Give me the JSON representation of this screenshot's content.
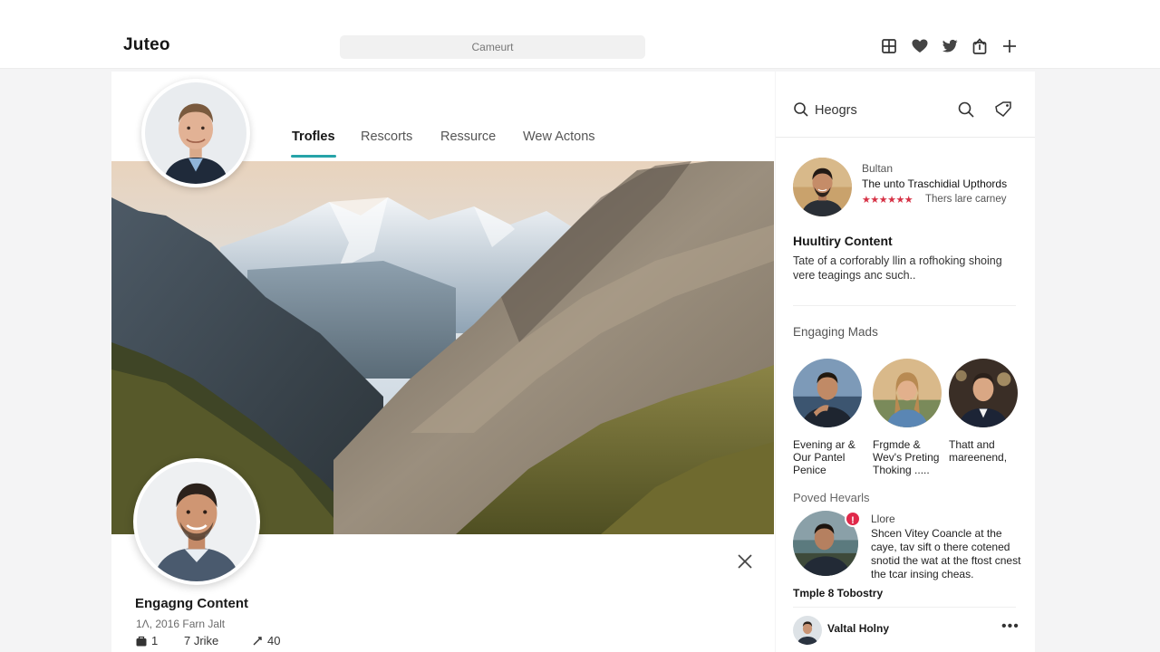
{
  "header": {
    "logo": "Juteo",
    "search_text": "Cameurt",
    "icons": [
      "grid-icon",
      "heart-icon",
      "bird-icon",
      "upload-icon",
      "plus-icon"
    ]
  },
  "main": {
    "tabs": [
      {
        "label": "Trofles",
        "active": true
      },
      {
        "label": "Rescorts",
        "active": false
      },
      {
        "label": "Ressurce",
        "active": false
      },
      {
        "label": "Wew Actons",
        "active": false
      }
    ],
    "post": {
      "title": "Engagng Content",
      "meta": "1Ʌ, 2016 Farn Jalt",
      "stats": {
        "comments": "1",
        "likes": "7 Jrike",
        "shares": "40"
      }
    }
  },
  "sidebar": {
    "header_label": "Heogrs",
    "featured": {
      "name": "Bultan",
      "title": "The unto Traschidial Upthords",
      "stars": "★★★★★★",
      "subtitle": "Thers lare carney"
    },
    "highlight": {
      "title": "Huultiry Content",
      "body": "Tate of a corforably llin a rofhoking shoing vere teagings anc such.."
    },
    "engaging": {
      "title": "Engaging Mads",
      "items": [
        {
          "caption": "Evening ar & Our Pantel Penice"
        },
        {
          "caption": "Frgmde & Wev's Preting Thoking ....."
        },
        {
          "caption": "Thatt and mareenend,"
        }
      ]
    },
    "poved": {
      "title": "Poved Hevarls",
      "badge": "!",
      "name": "Llore",
      "body": "Shcen Vitey Coancle at the caye, tav sift o there cotened snotid the wat at the ftost cnest the tcar insing cheas."
    },
    "template_title": "Tmple 8 Tobostry",
    "footer_user": "Valtal Holny",
    "more": "•••"
  },
  "colors": {
    "accent": "#26a3a8",
    "badge": "#e0294a",
    "stars": "#d63145"
  }
}
